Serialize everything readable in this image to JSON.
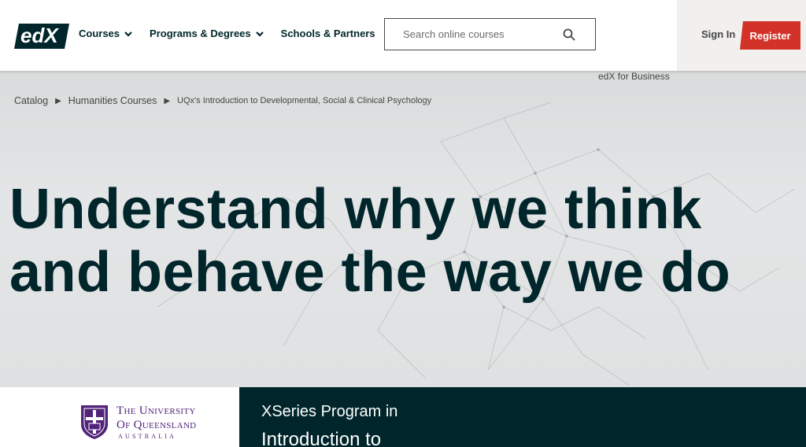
{
  "header": {
    "logo_text": "edX",
    "nav": [
      {
        "label": "Courses",
        "has_dropdown": true
      },
      {
        "label": "Programs & Degrees",
        "has_dropdown": true
      },
      {
        "label": "Schools & Partners",
        "has_dropdown": false
      }
    ],
    "search": {
      "placeholder": "Search online courses",
      "icon": "search-icon"
    },
    "signin_label": "Sign In",
    "register_label": "Register",
    "business_link": "edX for Business"
  },
  "breadcrumb": {
    "items": [
      "Catalog",
      "Humanities Courses"
    ],
    "current": "UQx's Introduction to Developmental, Social & Clinical Psychology"
  },
  "hero": {
    "title": "Understand why we think and behave the way we do"
  },
  "university": {
    "line1": "The University",
    "line2": "Of Queensland",
    "line3": "AUSTRALIA"
  },
  "program": {
    "label": "XSeries Program in",
    "title": "Introduction to"
  },
  "colors": {
    "brand_dark": "#00262b",
    "register_red": "#d23228",
    "uq_purple": "#51247a"
  }
}
